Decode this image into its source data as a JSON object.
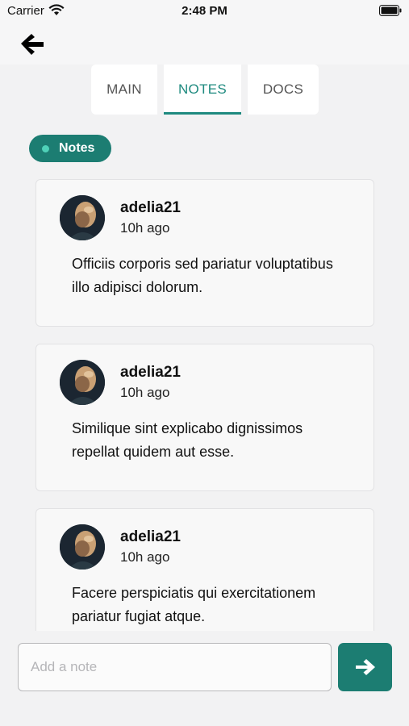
{
  "status": {
    "carrier": "Carrier",
    "time": "2:48 PM"
  },
  "tabs": [
    {
      "label": "MAIN",
      "active": false
    },
    {
      "label": "NOTES",
      "active": true
    },
    {
      "label": "DOCS",
      "active": false
    }
  ],
  "section_badge": "Notes",
  "notes": [
    {
      "author": "adelia21",
      "time": "10h ago",
      "text": "Officiis corporis sed pariatur voluptatibus illo adipisci dolorum."
    },
    {
      "author": "adelia21",
      "time": "10h ago",
      "text": "Similique sint explicabo dignissimos repellat quidem aut esse."
    },
    {
      "author": "adelia21",
      "time": "10h ago",
      "text": "Facere perspiciatis qui exercitationem pariatur fugiat atque."
    }
  ],
  "composer": {
    "placeholder": "Add a note",
    "value": ""
  },
  "colors": {
    "accent": "#1c7d72",
    "tab_active": "#1e8a7f",
    "badge_dot": "#4fd1b8"
  },
  "icons": {
    "back": "arrow-left-icon",
    "send": "arrow-right-icon",
    "wifi": "wifi-icon",
    "battery": "battery-icon"
  }
}
